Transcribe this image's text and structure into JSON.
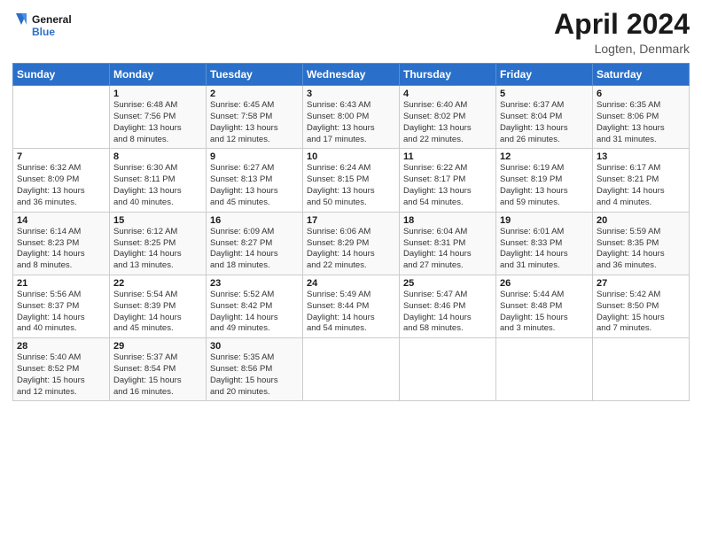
{
  "header": {
    "logo_general": "General",
    "logo_blue": "Blue",
    "title": "April 2024",
    "subtitle": "Logten, Denmark"
  },
  "days_of_week": [
    "Sunday",
    "Monday",
    "Tuesday",
    "Wednesday",
    "Thursday",
    "Friday",
    "Saturday"
  ],
  "weeks": [
    [
      {
        "day": "",
        "info": ""
      },
      {
        "day": "1",
        "info": "Sunrise: 6:48 AM\nSunset: 7:56 PM\nDaylight: 13 hours\nand 8 minutes."
      },
      {
        "day": "2",
        "info": "Sunrise: 6:45 AM\nSunset: 7:58 PM\nDaylight: 13 hours\nand 12 minutes."
      },
      {
        "day": "3",
        "info": "Sunrise: 6:43 AM\nSunset: 8:00 PM\nDaylight: 13 hours\nand 17 minutes."
      },
      {
        "day": "4",
        "info": "Sunrise: 6:40 AM\nSunset: 8:02 PM\nDaylight: 13 hours\nand 22 minutes."
      },
      {
        "day": "5",
        "info": "Sunrise: 6:37 AM\nSunset: 8:04 PM\nDaylight: 13 hours\nand 26 minutes."
      },
      {
        "day": "6",
        "info": "Sunrise: 6:35 AM\nSunset: 8:06 PM\nDaylight: 13 hours\nand 31 minutes."
      }
    ],
    [
      {
        "day": "7",
        "info": "Sunrise: 6:32 AM\nSunset: 8:09 PM\nDaylight: 13 hours\nand 36 minutes."
      },
      {
        "day": "8",
        "info": "Sunrise: 6:30 AM\nSunset: 8:11 PM\nDaylight: 13 hours\nand 40 minutes."
      },
      {
        "day": "9",
        "info": "Sunrise: 6:27 AM\nSunset: 8:13 PM\nDaylight: 13 hours\nand 45 minutes."
      },
      {
        "day": "10",
        "info": "Sunrise: 6:24 AM\nSunset: 8:15 PM\nDaylight: 13 hours\nand 50 minutes."
      },
      {
        "day": "11",
        "info": "Sunrise: 6:22 AM\nSunset: 8:17 PM\nDaylight: 13 hours\nand 54 minutes."
      },
      {
        "day": "12",
        "info": "Sunrise: 6:19 AM\nSunset: 8:19 PM\nDaylight: 13 hours\nand 59 minutes."
      },
      {
        "day": "13",
        "info": "Sunrise: 6:17 AM\nSunset: 8:21 PM\nDaylight: 14 hours\nand 4 minutes."
      }
    ],
    [
      {
        "day": "14",
        "info": "Sunrise: 6:14 AM\nSunset: 8:23 PM\nDaylight: 14 hours\nand 8 minutes."
      },
      {
        "day": "15",
        "info": "Sunrise: 6:12 AM\nSunset: 8:25 PM\nDaylight: 14 hours\nand 13 minutes."
      },
      {
        "day": "16",
        "info": "Sunrise: 6:09 AM\nSunset: 8:27 PM\nDaylight: 14 hours\nand 18 minutes."
      },
      {
        "day": "17",
        "info": "Sunrise: 6:06 AM\nSunset: 8:29 PM\nDaylight: 14 hours\nand 22 minutes."
      },
      {
        "day": "18",
        "info": "Sunrise: 6:04 AM\nSunset: 8:31 PM\nDaylight: 14 hours\nand 27 minutes."
      },
      {
        "day": "19",
        "info": "Sunrise: 6:01 AM\nSunset: 8:33 PM\nDaylight: 14 hours\nand 31 minutes."
      },
      {
        "day": "20",
        "info": "Sunrise: 5:59 AM\nSunset: 8:35 PM\nDaylight: 14 hours\nand 36 minutes."
      }
    ],
    [
      {
        "day": "21",
        "info": "Sunrise: 5:56 AM\nSunset: 8:37 PM\nDaylight: 14 hours\nand 40 minutes."
      },
      {
        "day": "22",
        "info": "Sunrise: 5:54 AM\nSunset: 8:39 PM\nDaylight: 14 hours\nand 45 minutes."
      },
      {
        "day": "23",
        "info": "Sunrise: 5:52 AM\nSunset: 8:42 PM\nDaylight: 14 hours\nand 49 minutes."
      },
      {
        "day": "24",
        "info": "Sunrise: 5:49 AM\nSunset: 8:44 PM\nDaylight: 14 hours\nand 54 minutes."
      },
      {
        "day": "25",
        "info": "Sunrise: 5:47 AM\nSunset: 8:46 PM\nDaylight: 14 hours\nand 58 minutes."
      },
      {
        "day": "26",
        "info": "Sunrise: 5:44 AM\nSunset: 8:48 PM\nDaylight: 15 hours\nand 3 minutes."
      },
      {
        "day": "27",
        "info": "Sunrise: 5:42 AM\nSunset: 8:50 PM\nDaylight: 15 hours\nand 7 minutes."
      }
    ],
    [
      {
        "day": "28",
        "info": "Sunrise: 5:40 AM\nSunset: 8:52 PM\nDaylight: 15 hours\nand 12 minutes."
      },
      {
        "day": "29",
        "info": "Sunrise: 5:37 AM\nSunset: 8:54 PM\nDaylight: 15 hours\nand 16 minutes."
      },
      {
        "day": "30",
        "info": "Sunrise: 5:35 AM\nSunset: 8:56 PM\nDaylight: 15 hours\nand 20 minutes."
      },
      {
        "day": "",
        "info": ""
      },
      {
        "day": "",
        "info": ""
      },
      {
        "day": "",
        "info": ""
      },
      {
        "day": "",
        "info": ""
      }
    ]
  ]
}
